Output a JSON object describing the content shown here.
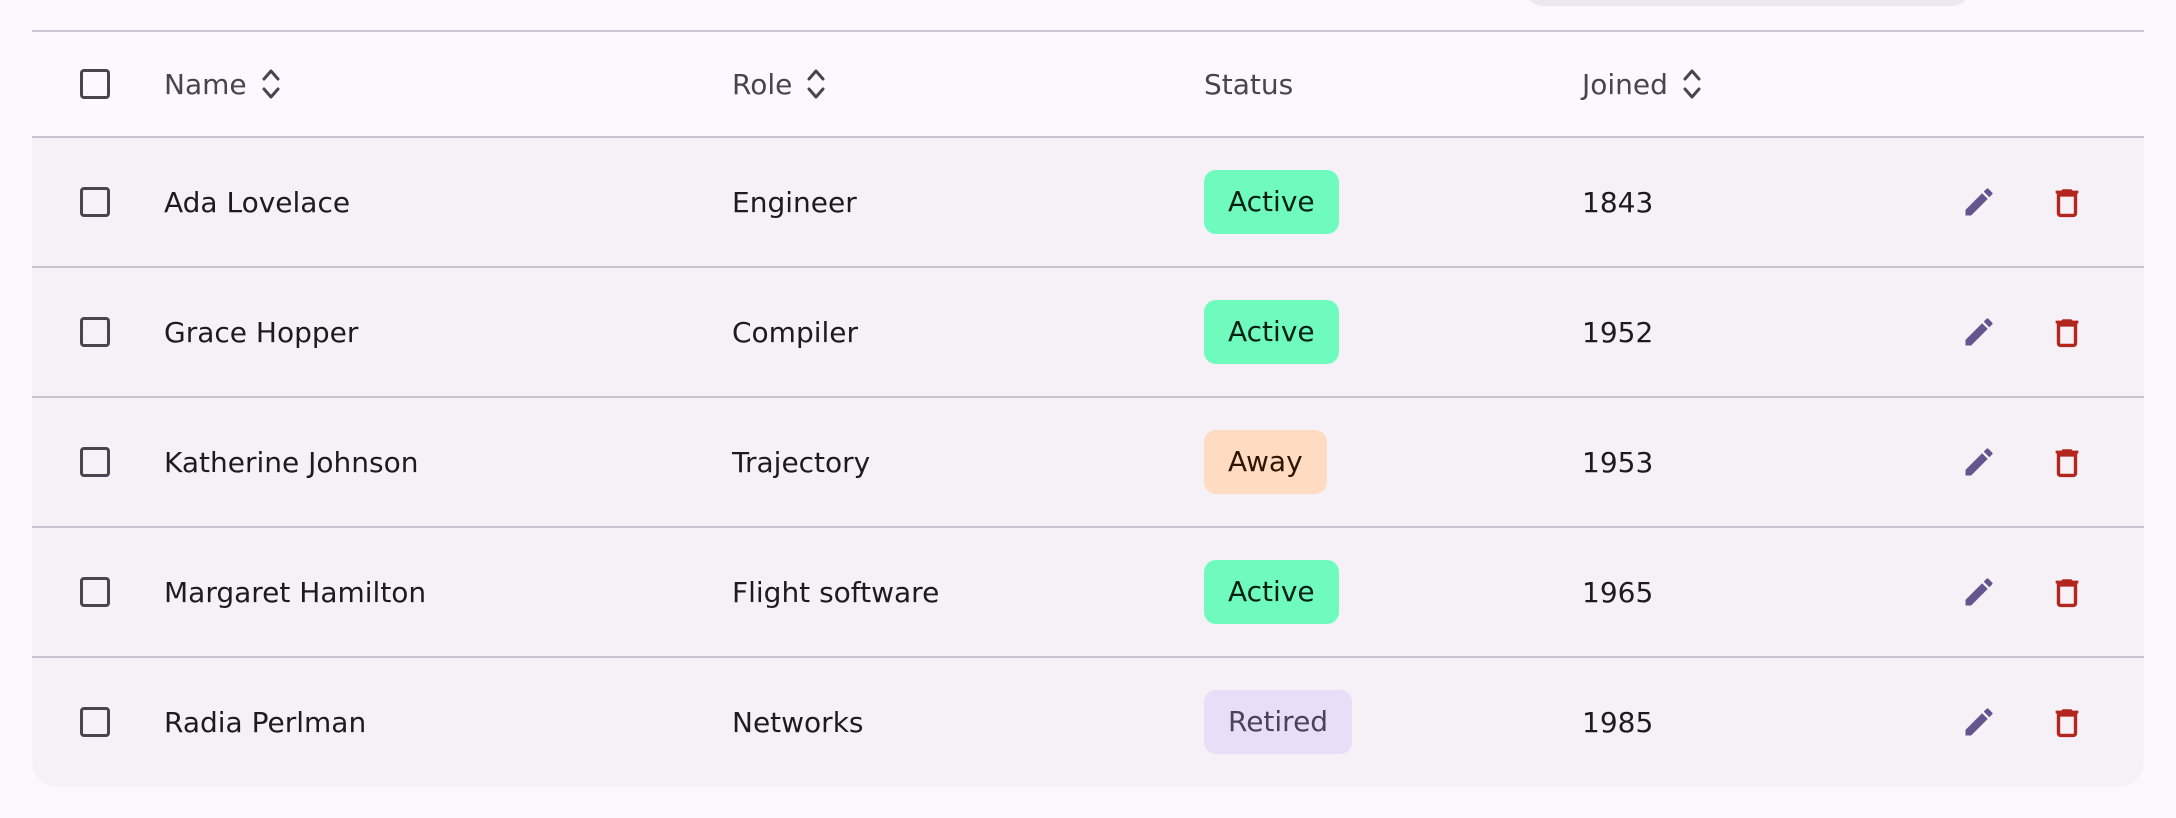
{
  "table": {
    "columns": {
      "name": "Name",
      "role": "Role",
      "status": "Status",
      "joined": "Joined"
    },
    "rows": [
      {
        "name": "Ada Lovelace",
        "role": "Engineer",
        "status": "Active",
        "status_kind": "active",
        "joined": "1843"
      },
      {
        "name": "Grace Hopper",
        "role": "Compiler",
        "status": "Active",
        "status_kind": "active",
        "joined": "1952"
      },
      {
        "name": "Katherine Johnson",
        "role": "Trajectory",
        "status": "Away",
        "status_kind": "away",
        "joined": "1953"
      },
      {
        "name": "Margaret Hamilton",
        "role": "Flight software",
        "status": "Active",
        "status_kind": "active",
        "joined": "1965"
      },
      {
        "name": "Radia Perlman",
        "role": "Networks",
        "status": "Retired",
        "status_kind": "retired",
        "joined": "1985"
      }
    ]
  },
  "icons": {
    "sort": "unfold-more-icon",
    "edit": "pencil-icon",
    "delete": "trash-icon"
  },
  "colors": {
    "active_badge": "#6ffbbe",
    "away_badge": "#ffdcc1",
    "retired_badge": "#e8def8",
    "edit_icon": "#65558f",
    "delete_icon": "#b3261e"
  }
}
